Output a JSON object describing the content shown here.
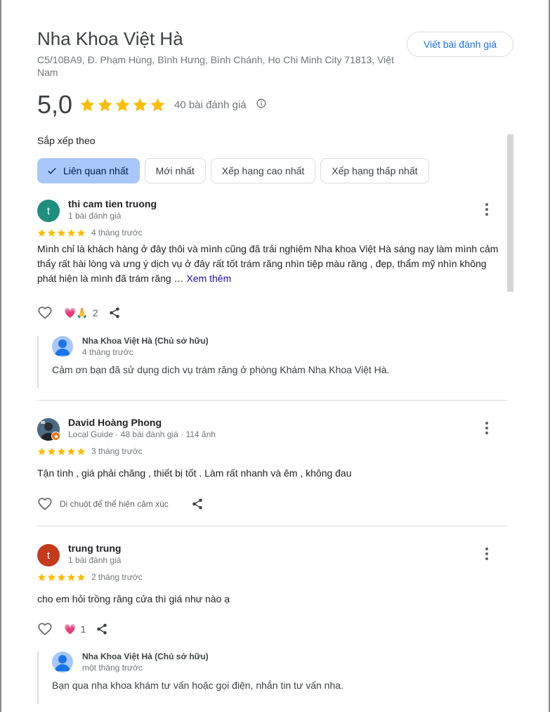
{
  "business": {
    "name": "Nha Khoa Việt Hà",
    "address": "C5/10BA9, Đ. Phạm Hùng, Bình Hưng, Bình Chánh, Ho Chi Minh City 71813, Việt Nam",
    "write_review_label": "Viết bài đánh giá",
    "rating": "5,0",
    "stars": 5,
    "review_count": "40 bài đánh giá"
  },
  "sort": {
    "label": "Sắp xếp theo",
    "options": [
      {
        "label": "Liên quan nhất",
        "selected": true
      },
      {
        "label": "Mới nhất",
        "selected": false
      },
      {
        "label": "Xếp hạng cao nhất",
        "selected": false
      },
      {
        "label": "Xếp hạng thấp nhất",
        "selected": false
      }
    ]
  },
  "reviews": [
    {
      "avatar_letter": "t",
      "avatar_color": "#1e8e7e",
      "name": "thi cam tien truong",
      "sub": "1 bài đánh giá",
      "stars": 5,
      "time": "4 tháng trước",
      "text": "Mình chỉ là khách hàng ở đây thôi và mình cũng đã trải nghiệm Nha khoa Việt Hà sáng nay làm mình cảm thấy rất hài lòng và ưng ý dịch vụ ở đây rất tốt trám răng nhìn tiệp màu răng , đẹp, thẩm mỹ nhìn không phát hiện là mình đã trám răng …",
      "more_label": "Xem thêm",
      "reactions": "💗🙏",
      "reaction_count": "2",
      "reply": {
        "name": "Nha Khoa Việt Hà (Chủ sở hữu)",
        "time": "4 tháng trước",
        "text": "Cảm ơn bạn đã sử dụng dịch vụ trám răng ở phòng Khám Nha Khoa Việt Hà."
      }
    },
    {
      "avatar_letter": "",
      "avatar_color": "#37474f",
      "name": "David Hoàng Phong",
      "sub": "Local Guide · 48 bài đánh giá · 114 ảnh",
      "stars": 5,
      "time": "3 tháng trước",
      "text": "Tận tình , giá phải chăng , thiết bị tốt . Làm rất nhanh và êm , không đau",
      "hover_text": "Di chuột để thể hiện cảm xúc"
    },
    {
      "avatar_letter": "t",
      "avatar_color": "#c5391d",
      "name": "trung trung",
      "sub": "1 bài đánh giá",
      "stars": 5,
      "time": "2 tháng trước",
      "text": "cho em hỏi trồng răng cửa thì giá như nào ạ",
      "reactions": "💗",
      "reaction_count": "1",
      "reply": {
        "name": "Nha Khoa Việt Hà (Chủ sở hữu)",
        "time": "một tháng trước",
        "text": "Bạn qua nha khoa khám tư vấn hoặc gọi điện, nhắn tin tư vấn nha."
      }
    }
  ],
  "colors": {
    "star": "#fbbc04",
    "accent": "#1a73e8",
    "selected_chip": "#a8c7fa"
  }
}
